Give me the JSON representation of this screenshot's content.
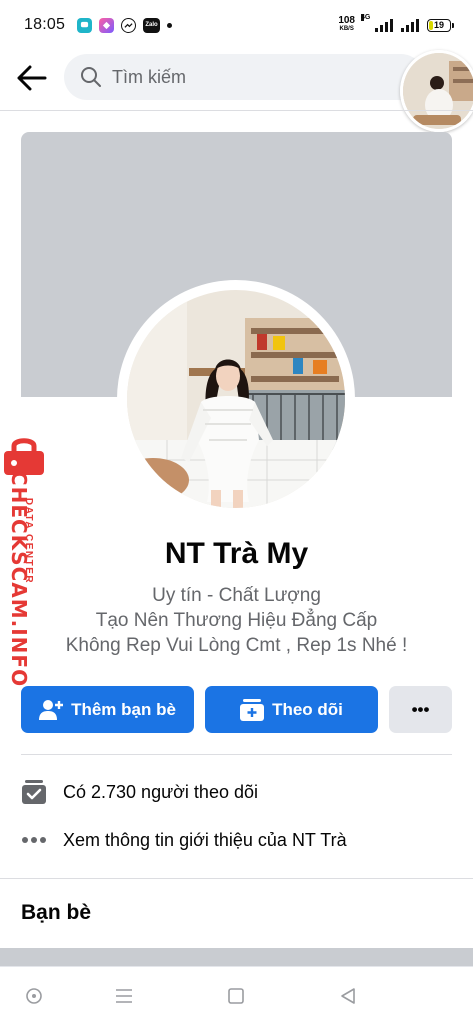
{
  "status_bar": {
    "time": "18:05",
    "app_icons": [
      "chat-bubble-icon",
      "shortcut-icon",
      "messenger-icon",
      "zalo-icon"
    ],
    "zalo_label": "Zalo",
    "net_speed_value": "108",
    "net_speed_unit": "KB/S",
    "network_type": "4G",
    "battery_level": "19"
  },
  "header": {
    "search_placeholder": "Tìm kiếm"
  },
  "profile": {
    "name": "NT Trà My",
    "bio": [
      "Uy tín - Chất Lượng",
      "Tạo Nên Thương Hiệu Đẳng Cấp",
      "Không Rep Vui Lòng Cmt , Rep 1s Nhé !"
    ]
  },
  "actions": {
    "add_friend_label": "Thêm bạn bè",
    "follow_label": "Theo dõi",
    "more_label": "•••"
  },
  "info": {
    "followers_text": "Có 2.730 người theo dõi",
    "about_text": "Xem thông tin giới thiệu của NT Trà"
  },
  "friends": {
    "title": "Bạn bè"
  },
  "watermark": {
    "main": "CHECKSCAM.INFO",
    "sub": "DATA CENTER"
  },
  "colors": {
    "primary_blue": "#1b74e4",
    "cover_gray": "#c9ccd1",
    "secondary_text": "#65676b",
    "watermark_red": "#e53935"
  }
}
